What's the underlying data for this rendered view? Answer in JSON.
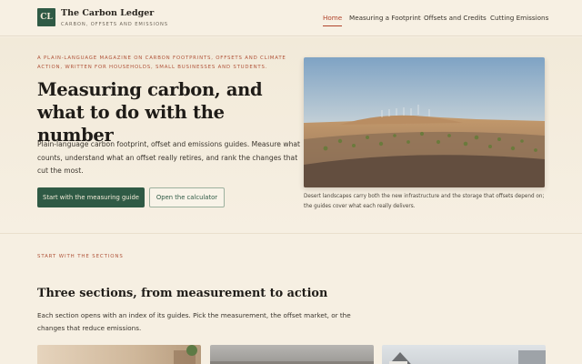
{
  "header": {
    "logo_initials": "CL",
    "brand_name": "The Carbon Ledger",
    "brand_tagline": "CARBON, OFFSETS AND EMISSIONS",
    "nav": [
      {
        "label": "Home",
        "active": true
      },
      {
        "label": "Measuring a Footprint",
        "active": false
      },
      {
        "label": "Offsets and Credits",
        "active": false
      },
      {
        "label": "Cutting Emissions",
        "active": false
      }
    ]
  },
  "hero": {
    "kicker": "A PLAIN-LANGUAGE MAGAZINE ON CARBON FOOTPRINTS, OFFSETS AND CLIMATE ACTION, WRITTEN FOR HOUSEHOLDS, SMALL BUSINESSES AND STUDENTS.",
    "title": "Measuring carbon, and what to do with the number",
    "lead": "Plain-language carbon footprint, offset and emissions guides. Measure what counts, understand what an offset really retires, and rank the changes that cut the most.",
    "primary_button": "Start with the measuring guide",
    "secondary_button": "Open the calculator",
    "image_caption": "Desert landscapes carry both the new infrastructure and the storage that offsets depend on; the guides cover what each really delivers."
  },
  "sections": {
    "kicker": "START WITH THE SECTIONS",
    "title": "Three sections, from measurement to action",
    "lead": "Each section opens with an index of its guides. Pick the measurement, the offset market, or the changes that reduce emissions."
  },
  "colors": {
    "accent_green": "#2f5a45",
    "accent_rust": "#b0432a",
    "background": "#f6efe2"
  }
}
